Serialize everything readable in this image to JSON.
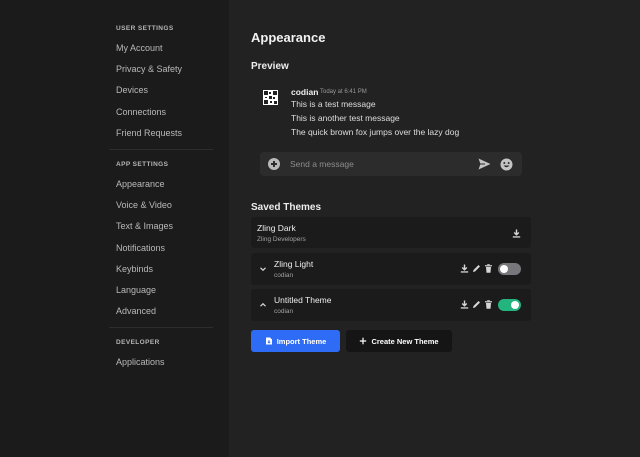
{
  "sidebar": {
    "user_settings_heading": "USER SETTINGS",
    "user_items": [
      {
        "label": "My Account"
      },
      {
        "label": "Privacy & Safety"
      },
      {
        "label": "Devices"
      },
      {
        "label": "Connections"
      },
      {
        "label": "Friend Requests"
      }
    ],
    "app_settings_heading": "APP SETTINGS",
    "app_items": [
      {
        "label": "Appearance"
      },
      {
        "label": "Voice & Video"
      },
      {
        "label": "Text & Images"
      },
      {
        "label": "Notifications"
      },
      {
        "label": "Keybinds"
      },
      {
        "label": "Language"
      },
      {
        "label": "Advanced"
      }
    ],
    "developer_heading": "DEVELOPER",
    "developer_items": [
      {
        "label": "Applications"
      }
    ]
  },
  "main": {
    "title": "Appearance",
    "preview_title": "Preview",
    "preview": {
      "author": "codian",
      "timestamp": "Today at 6:41 PM",
      "lines": [
        "This is a test message",
        "This is another test message",
        "The quick brown fox jumps over the lazy dog"
      ]
    },
    "composer": {
      "placeholder": "Send a message",
      "plus_icon": "plus-circle-icon",
      "send_icon": "send-icon",
      "emoji_icon": "emoji-icon"
    },
    "saved_themes_title": "Saved Themes",
    "themes": [
      {
        "name": "Zling Dark",
        "author": "Zling Developers"
      },
      {
        "name": "Zling Light",
        "author": "codian",
        "enabled": false
      },
      {
        "name": "Untitled Theme",
        "author": "codian",
        "enabled": true
      }
    ],
    "import_label": "Import Theme",
    "create_label": "Create New Theme"
  },
  "colors": {
    "accent": "#2f6cf6",
    "toggle_on": "#24b47e",
    "toggle_off": "#78787c"
  }
}
